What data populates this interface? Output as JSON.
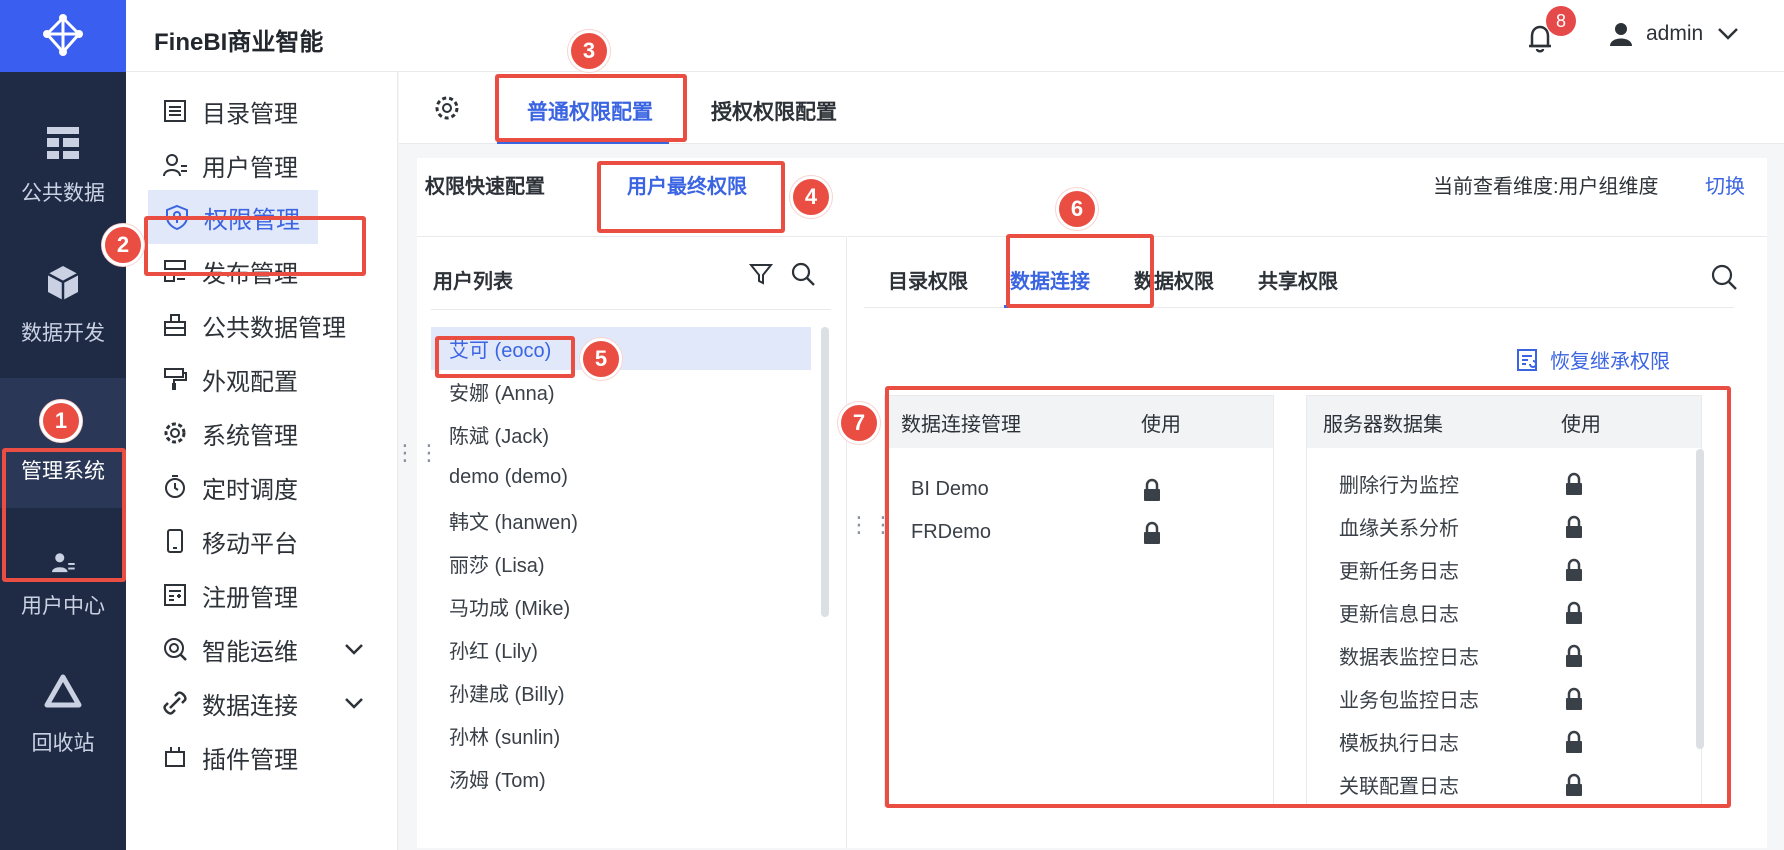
{
  "app": {
    "title": "FineBI商业智能",
    "notifications_count": "8",
    "user_name": "admin"
  },
  "rail": {
    "items": [
      {
        "label": "公共数据",
        "icon": "public-data-icon"
      },
      {
        "label": "数据开发",
        "icon": "data-dev-icon"
      },
      {
        "label": "管理系统",
        "icon": "system-gear-icon",
        "active": true
      },
      {
        "label": "用户中心",
        "icon": "user-center-icon"
      },
      {
        "label": "回收站",
        "icon": "recycle-icon"
      }
    ]
  },
  "menu": {
    "items": [
      {
        "label": "目录管理",
        "icon": "catalog-icon"
      },
      {
        "label": "用户管理",
        "icon": "user-icon"
      },
      {
        "label": "权限管理",
        "icon": "shield-icon",
        "active": true
      },
      {
        "label": "发布管理",
        "icon": "publish-icon"
      },
      {
        "label": "公共数据管理",
        "icon": "public-data-mgmt-icon"
      },
      {
        "label": "外观配置",
        "icon": "paint-icon"
      },
      {
        "label": "系统管理",
        "icon": "gear-icon"
      },
      {
        "label": "定时调度",
        "icon": "timer-icon"
      },
      {
        "label": "移动平台",
        "icon": "mobile-icon"
      },
      {
        "label": "注册管理",
        "icon": "register-icon"
      },
      {
        "label": "智能运维",
        "icon": "ops-icon",
        "expandable": true
      },
      {
        "label": "数据连接",
        "icon": "link-icon",
        "expandable": true
      },
      {
        "label": "插件管理",
        "icon": "plugin-icon"
      }
    ]
  },
  "tabs": {
    "normal": "普通权限配置",
    "grant": "授权权限配置"
  },
  "subtabs": {
    "quick": "权限快速配置",
    "final": "用户最终权限"
  },
  "dimension": {
    "label": "当前查看维度:用户组维度",
    "switch": "切换"
  },
  "user_list": {
    "title": "用户列表",
    "users": [
      "艾可 (eoco)",
      "安娜 (Anna)",
      "陈斌 (Jack)",
      "demo (demo)",
      "韩文 (hanwen)",
      "丽莎 (Lisa)",
      "马功成 (Mike)",
      "孙红 (Lily)",
      "孙建成 (Billy)",
      "孙林 (sunlin)",
      "汤姆 (Tom)"
    ],
    "selected_index": 0
  },
  "perm_tabs": [
    "目录权限",
    "数据连接",
    "数据权限",
    "共享权限"
  ],
  "perm_active": "数据连接",
  "restore_label": "恢复继承权限",
  "conn_table": {
    "header_name": "数据连接管理",
    "header_use": "使用",
    "rows": [
      "BI Demo",
      "FRDemo"
    ]
  },
  "dataset_table": {
    "header_name": "服务器数据集",
    "header_use": "使用",
    "rows": [
      "删除行为监控",
      "血缘关系分析",
      "更新任务日志",
      "更新信息日志",
      "数据表监控日志",
      "业务包监控日志",
      "模板执行日志",
      "关联配置日志"
    ]
  },
  "callouts": [
    "1",
    "2",
    "3",
    "4",
    "5",
    "6",
    "7"
  ],
  "colors": {
    "accent": "#3a64e2",
    "rail": "#1f2a44",
    "highlight": "#ea4e43"
  }
}
